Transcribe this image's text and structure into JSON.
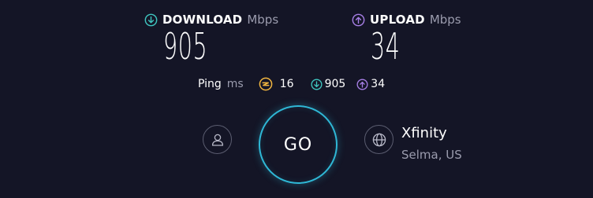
{
  "download": {
    "label": "DOWNLOAD",
    "unit": "Mbps",
    "value": "905",
    "icon": "download-arrow-icon",
    "color": "#3fc6c0"
  },
  "upload": {
    "label": "UPLOAD",
    "unit": "Mbps",
    "value": "34",
    "icon": "upload-arrow-icon",
    "color": "#a77fe6"
  },
  "ping": {
    "label": "Ping",
    "unit": "ms",
    "idle_icon": "ping-bolt-icon",
    "idle_color": "#f2b640",
    "idle_value": "16",
    "download_value": "905",
    "upload_value": "34"
  },
  "go_button": {
    "label": "GO",
    "color": "#2fb8d6"
  },
  "profile": {
    "icon": "user-icon"
  },
  "provider": {
    "icon": "globe-icon",
    "name": "Xfinity",
    "location": "Selma, US"
  },
  "colors": {
    "background": "#141526",
    "muted_text": "#9b9cae",
    "circle_border": "#5b5d70"
  }
}
